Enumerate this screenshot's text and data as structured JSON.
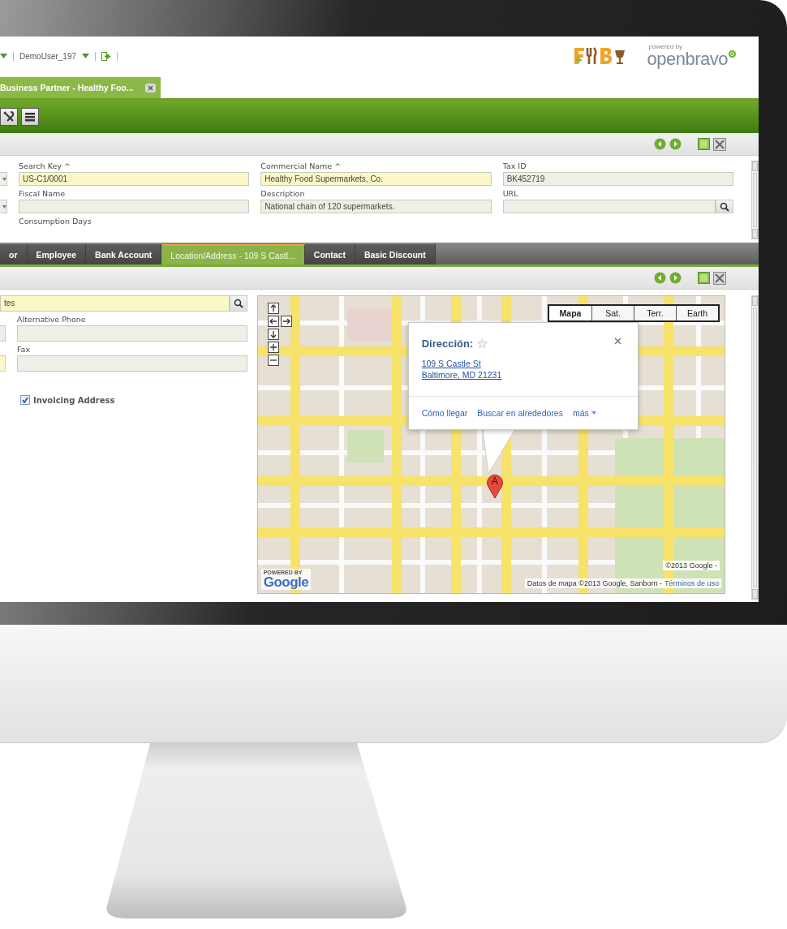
{
  "top_bar": {
    "user": "DemoUser_197",
    "logo": {
      "tagline": "powered by",
      "brand": "openbravo"
    }
  },
  "window_tabs": [
    {
      "label": "Business Partner - Healthy Foo...",
      "selected": true
    }
  ],
  "header_form": {
    "rows": [
      {
        "cut_field": {
          "required": false
        },
        "fields": [
          {
            "label": "Search Key ^",
            "value": "US-C1/0001",
            "required": true,
            "kind": "text"
          },
          {
            "label": "Commercial Name ^",
            "value": "Healthy Food Supermarkets, Co.",
            "required": true,
            "kind": "text"
          },
          {
            "label": "Tax ID",
            "value": "BK452719",
            "required": false,
            "kind": "text"
          }
        ]
      },
      {
        "cut_field": {
          "required": false
        },
        "fields": [
          {
            "label": "Fiscal Name",
            "required": false,
            "kind": "text"
          },
          {
            "label": "Description",
            "value": "National chain of 120 supermarkets.",
            "required": false,
            "kind": "text"
          },
          {
            "label": "URL",
            "required": false,
            "kind": "search"
          }
        ]
      },
      {
        "fields": [
          {
            "label": "Consumption Days",
            "kind": "label"
          }
        ]
      }
    ]
  },
  "subtabs": [
    {
      "label": "or",
      "selected": false
    },
    {
      "label": "Employee",
      "selected": false
    },
    {
      "label": "Bank Account",
      "selected": false
    },
    {
      "label": "Location/Address - 109 S Castl...",
      "selected": true
    },
    {
      "label": "Contact",
      "selected": false
    },
    {
      "label": "Basic Discount",
      "selected": false
    }
  ],
  "location_form": {
    "search_field": {
      "value": "tes",
      "required": true
    },
    "rows": [
      {
        "cut_field": {
          "required": false
        },
        "label": "Alternative Phone",
        "required": false
      },
      {
        "cut_field": {
          "required": true
        },
        "label": "Fax",
        "required": false
      }
    ],
    "checkbox": {
      "label": "Invoicing Address",
      "checked": true
    }
  },
  "map": {
    "map_types": [
      {
        "label": "Mapa",
        "selected": true
      },
      {
        "label": "Sat.",
        "selected": false
      },
      {
        "label": "Terr.",
        "selected": false
      },
      {
        "label": "Earth",
        "selected": false
      }
    ],
    "popup": {
      "title": "Dirección:",
      "address": [
        "109 S Castle St",
        "Baltimore, MD 21231"
      ],
      "actions": [
        "Cómo llegar",
        "Buscar en alrededores",
        "más"
      ]
    },
    "marker": "A",
    "copyright": "©2013 Google -",
    "attribution": "Datos de mapa ©2013 Google, Sanborn -",
    "terms_link": "Términos de uso",
    "powered_by": "POWERED BY",
    "google_logo": "Google"
  }
}
